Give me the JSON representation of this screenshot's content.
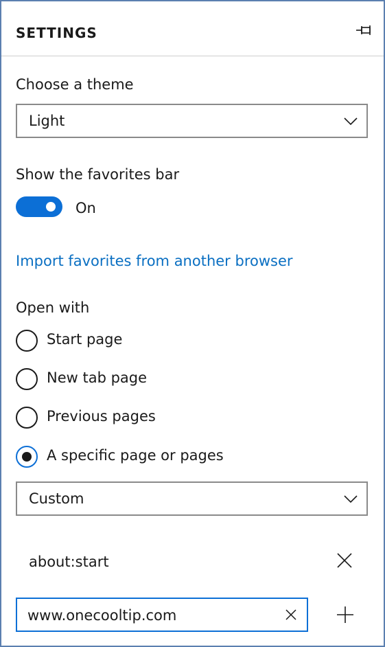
{
  "header": {
    "title": "SETTINGS",
    "pin_icon": "pin-icon"
  },
  "theme": {
    "label": "Choose a theme",
    "value": "Light"
  },
  "favorites_bar": {
    "label": "Show the favorites bar",
    "state": "On",
    "on": true
  },
  "import_link": "Import favorites from another browser",
  "open_with": {
    "label": "Open with",
    "options": [
      {
        "label": "Start page",
        "checked": false
      },
      {
        "label": "New tab page",
        "checked": false
      },
      {
        "label": "Previous pages",
        "checked": false
      },
      {
        "label": "A specific page or pages",
        "checked": true
      }
    ],
    "page_select_value": "Custom",
    "pages": [
      {
        "url": "about:start"
      }
    ],
    "new_page_input": "www.onecooltip.com"
  },
  "colors": {
    "accent": "#0c6fd6",
    "link": "#0a6fc2",
    "border": "#5b7fb0"
  }
}
